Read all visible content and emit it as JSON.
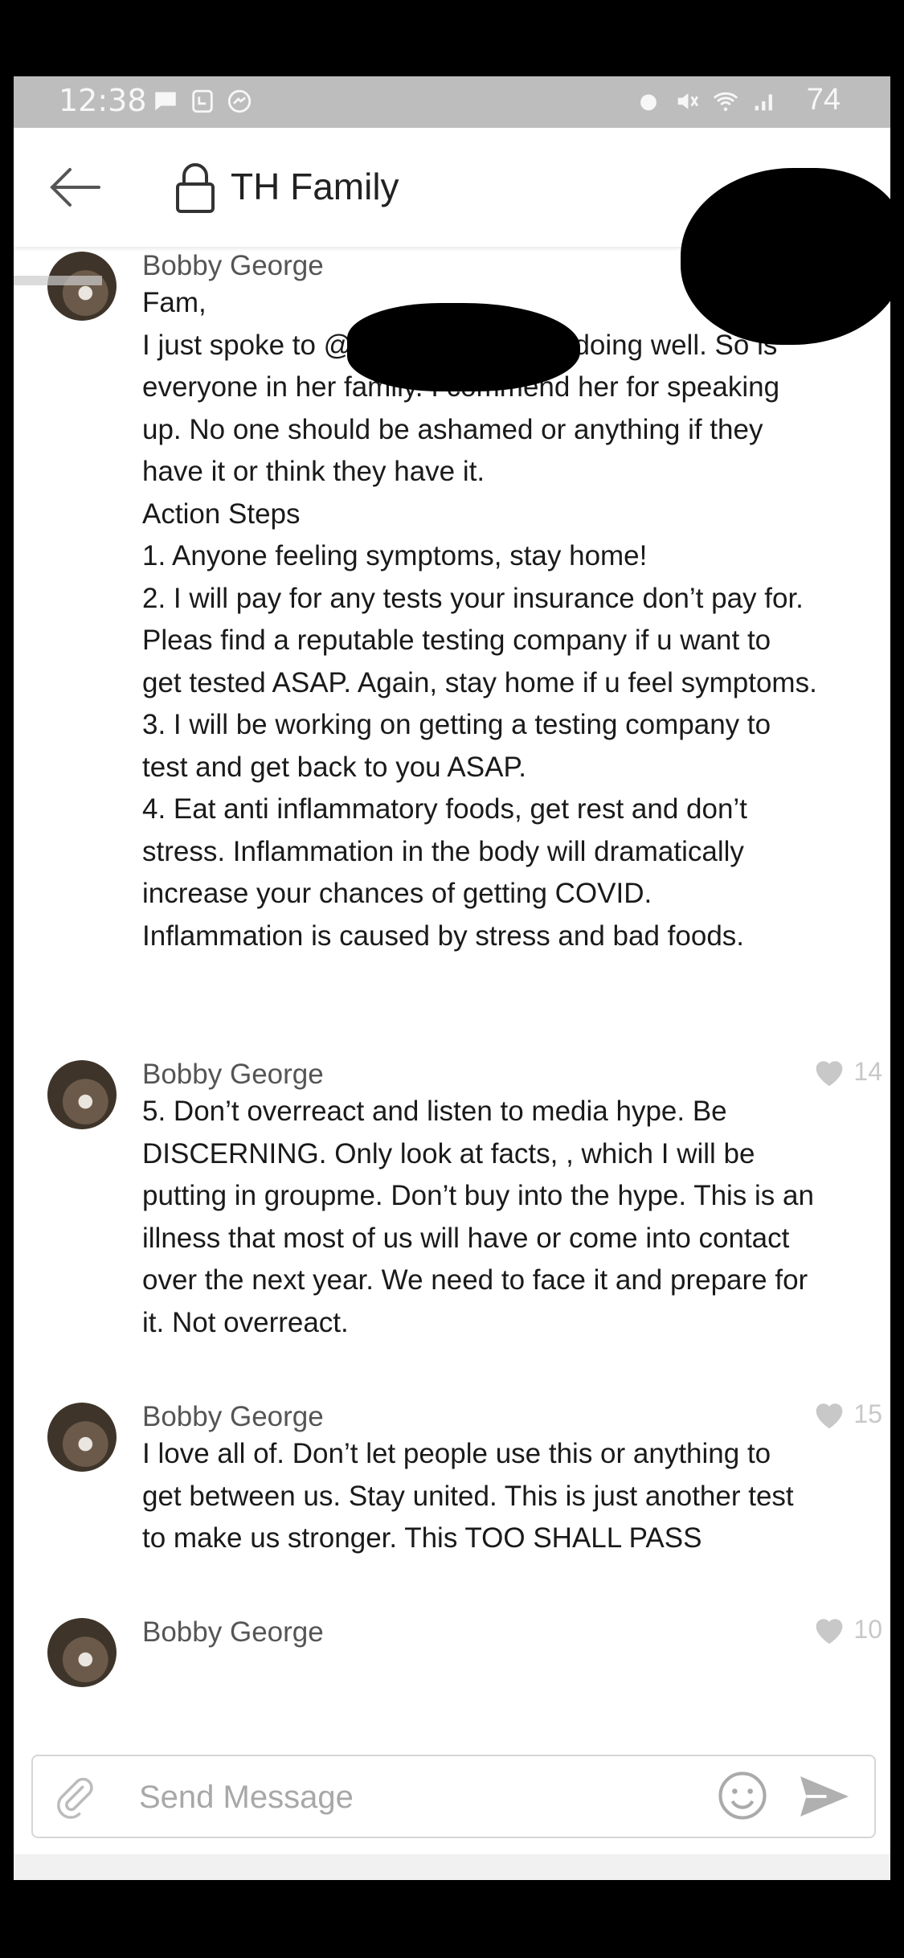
{
  "status_bar": {
    "time": "12:38",
    "battery": "74"
  },
  "header": {
    "title": "TH Family"
  },
  "messages": [
    {
      "sender": "Bobby George",
      "body": "Fam,\nI just spoke to @Nicole                 and she is doing well. So is everyone in her family. I commend her for speaking up. No one should be ashamed or anything if they have it or think they have it.\nAction Steps\n1. Anyone feeling symptoms, stay home!\n2. I will pay for any tests your insurance don’t pay for. Pleas find a reputable testing company if u want to get tested ASAP. Again, stay home if u feel symptoms.\n3. I will be working on getting a testing company to test and get back to you ASAP.\n4. Eat anti inflammatory foods, get rest and don’t stress. Inflammation in the body will dramatically increase your chances of getting COVID. Inflammation is caused by stress and bad foods.",
      "likes": ""
    },
    {
      "sender": "Bobby George",
      "body": "5. Don’t overreact and listen to media hype. Be DISCERNING. Only look at facts, , which I will be putting in groupme. Don’t buy into the hype. This is an illness that most of us will have or come into contact over the next year.  We need to face it and prepare for it.  Not overreact.",
      "likes": "14"
    },
    {
      "sender": "Bobby George",
      "body": "I love all of. Don’t let people use this or anything to get between us. Stay united.  This is just another test to make us stronger. This TOO SHALL PASS",
      "likes": "15"
    },
    {
      "sender": "Bobby George",
      "body": "",
      "likes": "10"
    }
  ],
  "composer": {
    "placeholder": "Send Message"
  },
  "icons": {
    "back": "arrow-left-icon",
    "lock": "lock-icon",
    "attach": "paperclip-icon",
    "emoji": "smiley-icon",
    "send": "send-icon",
    "heart": "heart-icon"
  },
  "colors": {
    "like_gray": "#c8c8c8",
    "status_bar": "#bdbdbd"
  }
}
